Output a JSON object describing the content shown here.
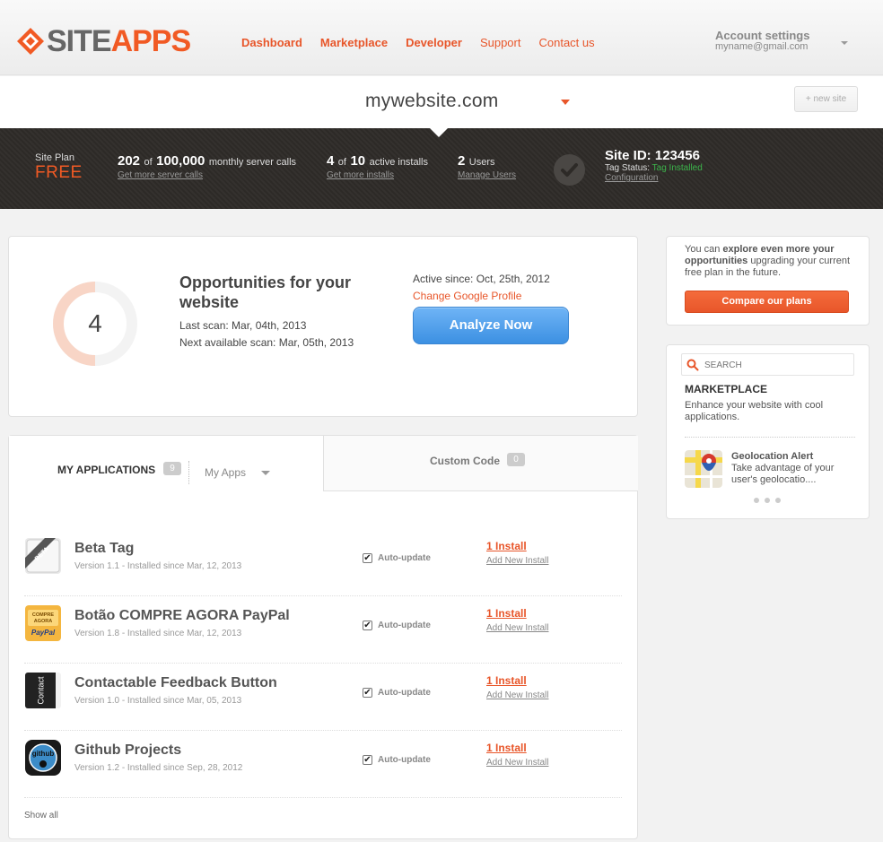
{
  "brand": {
    "part1": "SITE",
    "part2": "APPS",
    "accent": "#f15a24"
  },
  "nav": [
    {
      "label": "Dashboard"
    },
    {
      "label": "Marketplace"
    },
    {
      "label": "Developer"
    },
    {
      "label": "Support"
    },
    {
      "label": "Contact us"
    }
  ],
  "account": {
    "title": "Account settings",
    "email": "myname@gmail.com"
  },
  "site": {
    "name": "mywebsite.com",
    "new_site": "+ new site"
  },
  "stats": {
    "plan_label": "Site Plan",
    "plan_value": "FREE",
    "calls_used": "202",
    "calls_of": "of",
    "calls_total": "100,000",
    "calls_label": "monthly server calls",
    "calls_link": "Get more server calls",
    "installs_used": "4",
    "installs_of": "of",
    "installs_total": "10",
    "installs_label": "active installs",
    "installs_link": "Get more installs",
    "users_count": "2",
    "users_label": "Users",
    "users_link": "Manage Users",
    "site_id_label": "Site ID:",
    "site_id": "123456",
    "tag_status_label": "Tag Status:",
    "tag_status": "Tag Installed",
    "configuration_link": "Configuration"
  },
  "opportunities": {
    "count": "4",
    "title": "Opportunities for your website",
    "last_scan": "Last scan: Mar, 04th, 2013",
    "next_scan": "Next available scan: Mar, 05th, 2013",
    "active_since": "Active since: Oct, 25th, 2012",
    "change_google": "Change Google Profile",
    "analyze_button": "Analyze Now"
  },
  "apps_panel": {
    "tab_my_apps": "MY APPLICATIONS",
    "my_apps_count": "9",
    "filter_value": "My Apps",
    "tab_custom": "Custom Code",
    "custom_count": "0",
    "show_all": "Show all",
    "auto_update_label": "Auto-update",
    "add_new_label": "Add New Install",
    "items": [
      {
        "name": "Beta Tag",
        "version": "Version 1.1 - Installed since Mar, 12, 2013",
        "installs": "1 Install",
        "icon": "beta-tag-icon"
      },
      {
        "name": "Botão COMPRE AGORA PayPal",
        "version": "Version 1.8 - Installed since Mar, 12, 2013",
        "installs": "1 Install",
        "icon": "paypal-icon"
      },
      {
        "name": "Contactable Feedback Button",
        "version": "Version 1.0 - Installed since Mar, 05, 2013",
        "installs": "1 Install",
        "icon": "contact-icon"
      },
      {
        "name": "Github Projects",
        "version": "Version 1.2 - Installed since Sep, 28, 2012",
        "installs": "1 Install",
        "icon": "github-icon"
      }
    ]
  },
  "upsell": {
    "text_pre": "You can",
    "text_bold": "explore even more your opportunities",
    "text_post": "upgrading your current free plan in the future.",
    "button": "Compare our plans"
  },
  "marketplace": {
    "search_placeholder": "SEARCH",
    "title": "MARKETPLACE",
    "description": "Enhance your website with cool applications.",
    "featured_name": "Geolocation Alert",
    "featured_desc": "Take advantage of your user's geolocatio...."
  }
}
